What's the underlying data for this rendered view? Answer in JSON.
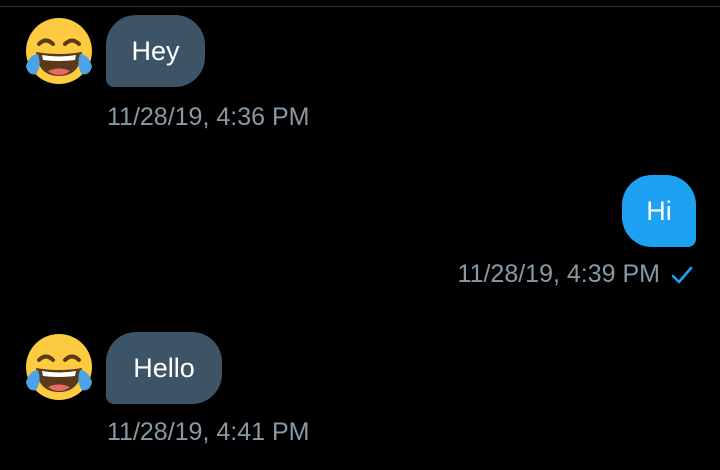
{
  "messages": [
    {
      "direction": "incoming",
      "text": "Hey",
      "timestamp": "11/28/19, 4:36 PM",
      "avatar": "face-with-tears-of-joy-emoji"
    },
    {
      "direction": "outgoing",
      "text": "Hi",
      "timestamp": "11/28/19, 4:39 PM",
      "status_icon": "checkmark-sent-icon"
    },
    {
      "direction": "incoming",
      "text": "Hello",
      "timestamp": "11/28/19, 4:41 PM",
      "avatar": "face-with-tears-of-joy-emoji"
    }
  ],
  "colors": {
    "background": "#000000",
    "incoming_bubble": "#3d5466",
    "outgoing_bubble": "#1da1f2",
    "timestamp_text": "#8899a6",
    "emoji_face": "#fdcb3f"
  }
}
